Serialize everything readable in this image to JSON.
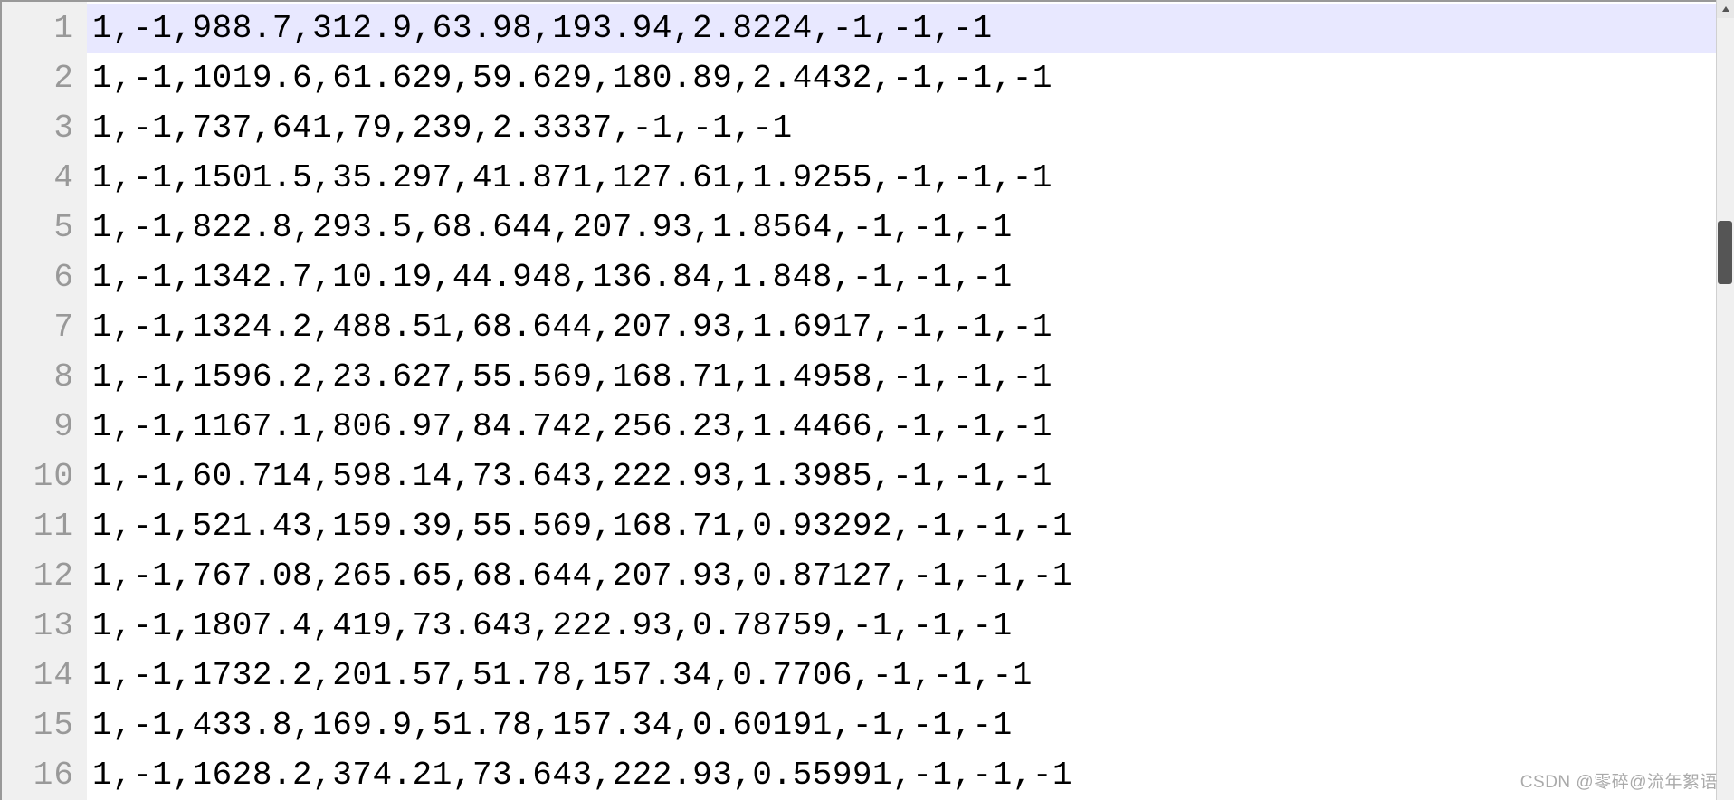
{
  "gutter": {
    "start": 1,
    "end": 16
  },
  "lines": [
    "1,-1,988.7,312.9,63.98,193.94,2.8224,-1,-1,-1",
    "1,-1,1019.6,61.629,59.629,180.89,2.4432,-1,-1,-1",
    "1,-1,737,641,79,239,2.3337,-1,-1,-1",
    "1,-1,1501.5,35.297,41.871,127.61,1.9255,-1,-1,-1",
    "1,-1,822.8,293.5,68.644,207.93,1.8564,-1,-1,-1",
    "1,-1,1342.7,10.19,44.948,136.84,1.848,-1,-1,-1",
    "1,-1,1324.2,488.51,68.644,207.93,1.6917,-1,-1,-1",
    "1,-1,1596.2,23.627,55.569,168.71,1.4958,-1,-1,-1",
    "1,-1,1167.1,806.97,84.742,256.23,1.4466,-1,-1,-1",
    "1,-1,60.714,598.14,73.643,222.93,1.3985,-1,-1,-1",
    "1,-1,521.43,159.39,55.569,168.71,0.93292,-1,-1,-1",
    "1,-1,767.08,265.65,68.644,207.93,0.87127,-1,-1,-1",
    "1,-1,1807.4,419,73.643,222.93,0.78759,-1,-1,-1",
    "1,-1,1732.2,201.57,51.78,157.34,0.7706,-1,-1,-1",
    "1,-1,433.8,169.9,51.78,157.34,0.60191,-1,-1,-1",
    "1,-1,1628.2,374.21,73.643,222.93,0.55991,-1,-1,-1"
  ],
  "currentLine": 0,
  "watermark": "CSDN @零碎@流年絮语"
}
